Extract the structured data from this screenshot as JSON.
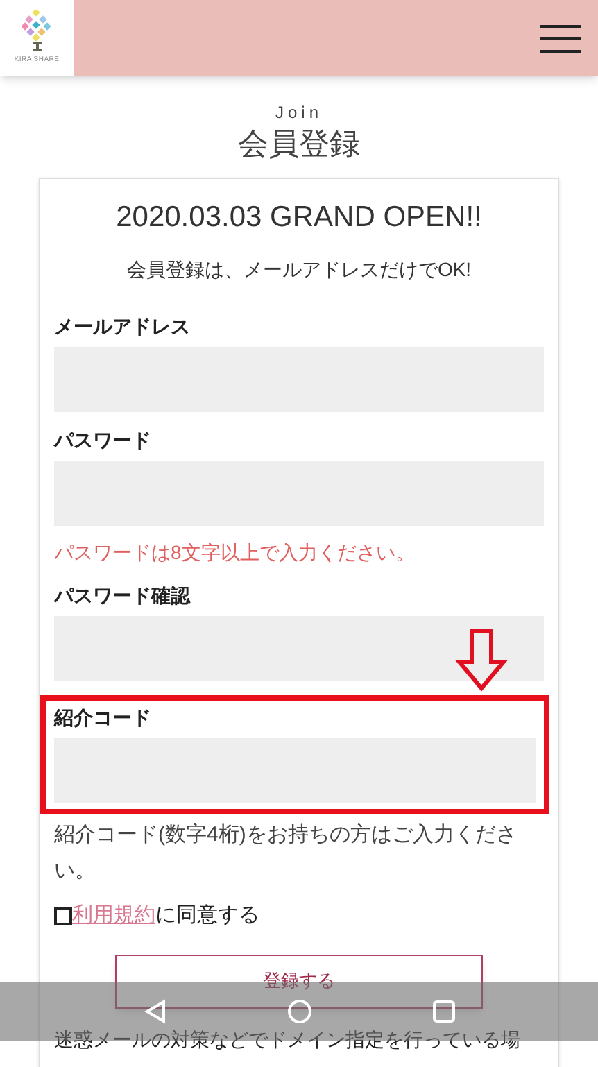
{
  "header": {
    "logo_text": "KIRA SHARE"
  },
  "page_title": {
    "eyebrow": "Join",
    "title": "会員登録"
  },
  "card": {
    "headline": "2020.03.03 GRAND OPEN!!",
    "intro": "会員登録は、メールアドレスだけでOK!",
    "fields": [
      {
        "label": "メールアドレス",
        "highlighted": false
      },
      {
        "label": "パスワード",
        "error": "パスワードは8文字以上で入力ください。",
        "highlighted": false
      },
      {
        "label": "パスワード確認",
        "highlighted": false
      },
      {
        "label": "紹介コード",
        "highlighted": true
      }
    ],
    "note": "紹介コード(数字4桁)をお持ちの方はご入力ください。",
    "agree": {
      "checked": false,
      "link": "利用規約",
      "text": "に同意する"
    },
    "submit": "登録する",
    "footer_text": "迷惑メールの対策などでドメイン指定を行っている場"
  }
}
